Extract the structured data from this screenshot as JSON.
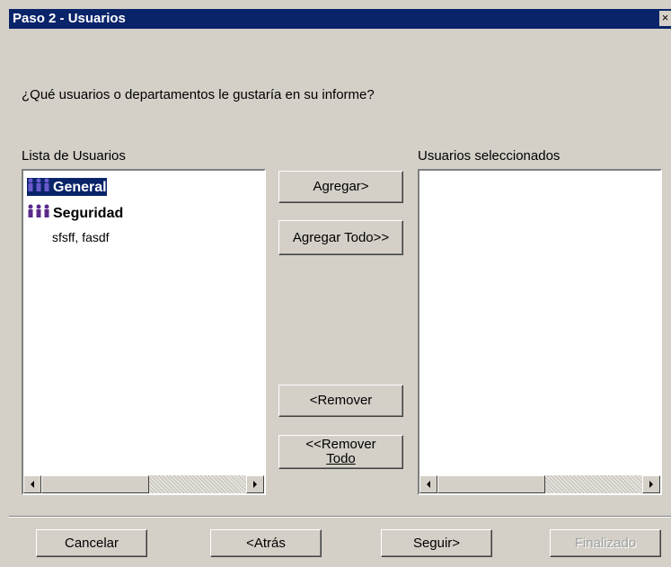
{
  "window": {
    "title": "Paso 2 - Usuarios",
    "close_glyph": "×"
  },
  "prompt": "¿Qué usuarios o  departamentos le gustaría en su informe?",
  "left_list": {
    "label": "Lista de Usuarios",
    "items": [
      {
        "text": "General",
        "type": "group",
        "selected": true,
        "icon": "user-group-icon"
      },
      {
        "text": "Seguridad",
        "type": "group",
        "selected": false,
        "icon": "user-group-icon"
      },
      {
        "text": "sfsff, fasdf",
        "type": "user",
        "selected": false
      }
    ]
  },
  "right_list": {
    "label": "Usuarios seleccionados",
    "items": []
  },
  "buttons": {
    "add": "Agregar>",
    "add_all": "Agregar Todo>>",
    "remove": "<Remover",
    "remove_all_line1": "<<Remover",
    "remove_all_line2": "Todo"
  },
  "footer": {
    "cancel": "Cancelar",
    "back": "<Atrás",
    "next": "Seguir>",
    "finish": "Finalizado",
    "finish_enabled": false
  },
  "colors": {
    "selection": "#0a246a",
    "face": "#d4d0c8"
  }
}
